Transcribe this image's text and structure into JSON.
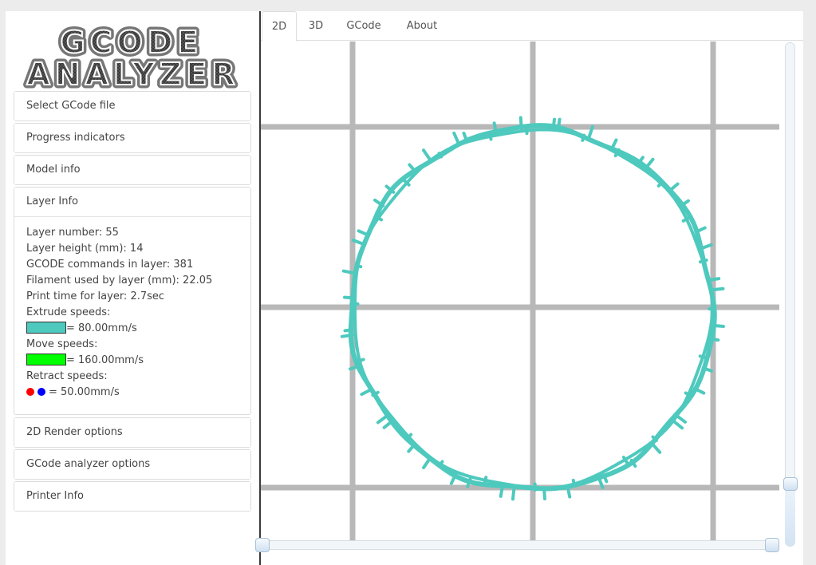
{
  "logo": {
    "line1": "GCODE",
    "line2": "ANALYZER"
  },
  "accordion": {
    "select_file": "Select GCode file",
    "progress": "Progress indicators",
    "model_info": "Model info",
    "layer_info": "Layer Info",
    "render_options": "2D Render options",
    "analyzer_options": "GCode analyzer options",
    "printer_info": "Printer Info"
  },
  "layer_info": {
    "layer_number": "Layer number: 55",
    "layer_height": "Layer height (mm): 14",
    "commands": "GCODE commands in layer: 381",
    "filament": "Filament used by layer (mm): 22.05",
    "print_time": "Print time for layer: 2.7sec",
    "extrude_label": "Extrude speeds:",
    "extrude_value": "= 80.00mm/s",
    "move_label": "Move speeds:",
    "move_value": "= 160.00mm/s",
    "retract_label": "Retract speeds:",
    "retract_value": "= 50.00mm/s"
  },
  "colors": {
    "extrude": "#4ec9be",
    "move": "#00ff00",
    "retract_1": "#ff0000",
    "retract_2": "#0000ff",
    "grid": "#b8b8b8"
  },
  "tabs": [
    {
      "label": "2D",
      "active": true
    },
    {
      "label": "3D",
      "active": false
    },
    {
      "label": "GCode",
      "active": false
    },
    {
      "label": "About",
      "active": false
    }
  ],
  "sliders": {
    "layer_position": 1.0,
    "range_start": 0.0,
    "range_end": 1.0
  }
}
